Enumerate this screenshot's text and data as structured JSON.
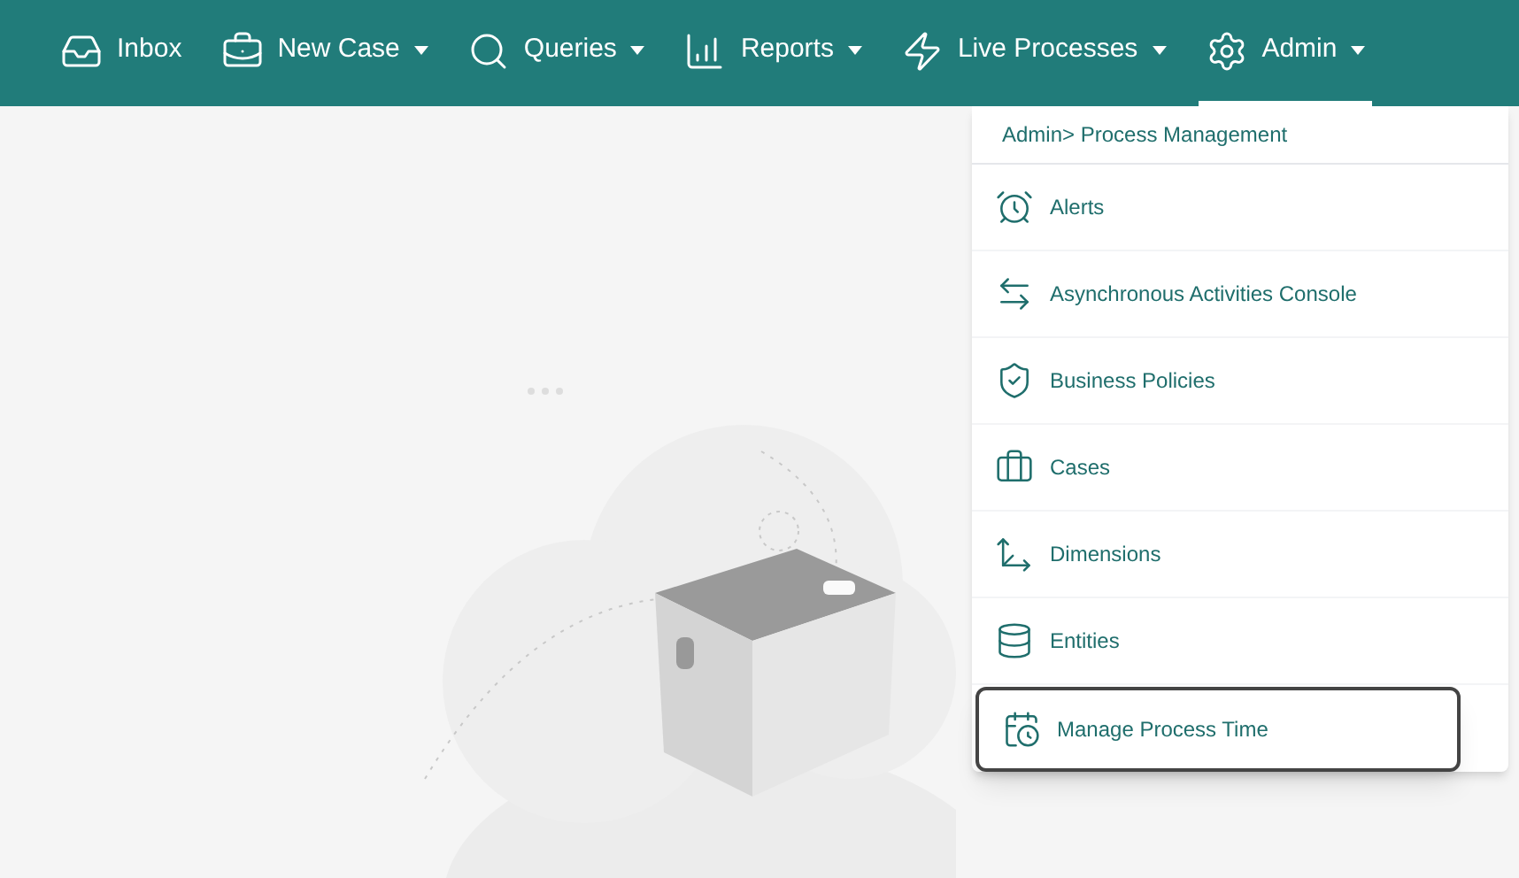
{
  "nav": [
    {
      "label": "Inbox",
      "has_caret": false,
      "selected": false
    },
    {
      "label": "New Case",
      "has_caret": true,
      "selected": false
    },
    {
      "label": "Queries",
      "has_caret": true,
      "selected": false
    },
    {
      "label": "Reports",
      "has_caret": true,
      "selected": false
    },
    {
      "label": "Live Processes",
      "has_caret": true,
      "selected": false
    },
    {
      "label": "Admin",
      "has_caret": true,
      "selected": true
    }
  ],
  "menu": {
    "breadcrumb": "Admin> Process Management",
    "items": [
      {
        "label": "Alerts",
        "selected": false
      },
      {
        "label": "Asynchronous Activities Console",
        "selected": false
      },
      {
        "label": "Business Policies",
        "selected": false
      },
      {
        "label": "Cases",
        "selected": false
      },
      {
        "label": "Dimensions",
        "selected": false
      },
      {
        "label": "Entities",
        "selected": false
      },
      {
        "label": "Manage Process Time",
        "selected": true
      }
    ]
  }
}
